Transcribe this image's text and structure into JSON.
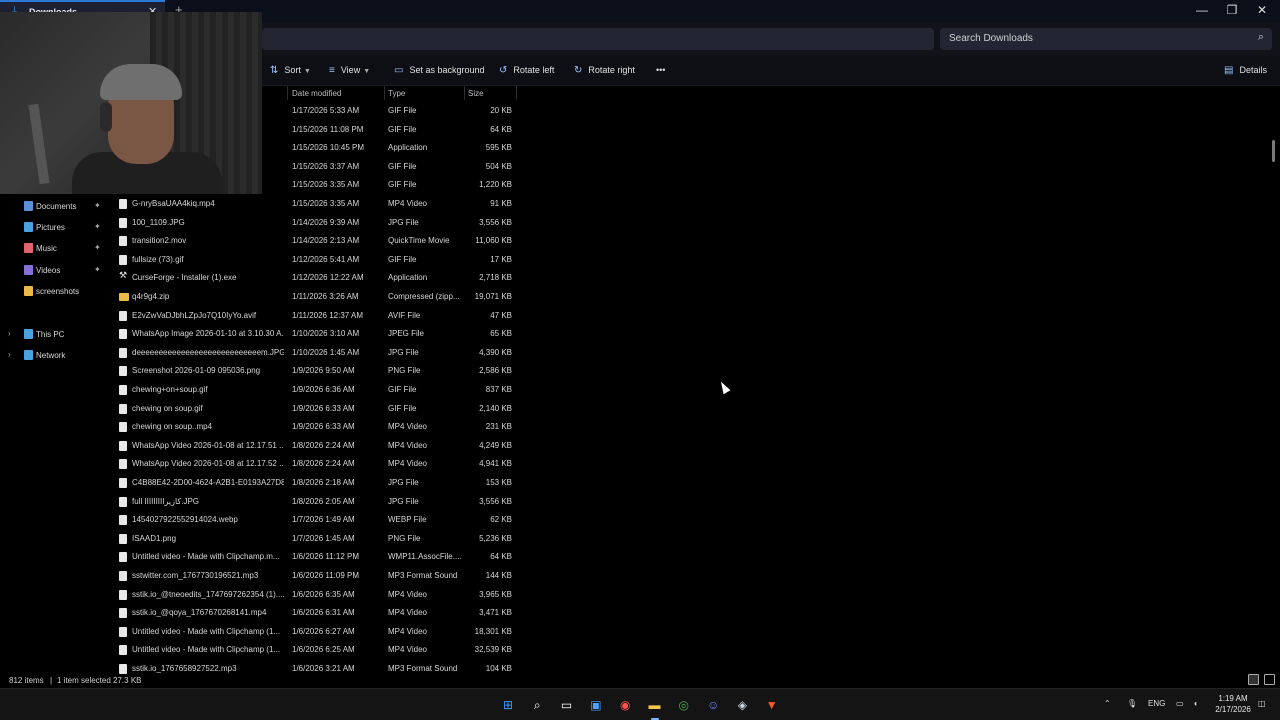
{
  "window": {
    "tab_title": "Downloads",
    "new_tab": "+",
    "close_tab": "✕",
    "minimize": "—",
    "restore": "❐",
    "close": "✕"
  },
  "search": {
    "placeholder": "Search Downloads"
  },
  "toolbar": {
    "sort": "Sort",
    "view": "View",
    "set_background": "Set as background",
    "rotate_left": "Rotate left",
    "rotate_right": "Rotate right",
    "more": "•••",
    "details": "Details"
  },
  "columns": {
    "date": "Date modified",
    "type": "Type",
    "size": "Size"
  },
  "sidebar": {
    "pinned": [
      {
        "label": "Documents",
        "icon": "documents-icon",
        "color": "#5b8fd6"
      },
      {
        "label": "Pictures",
        "icon": "pictures-icon",
        "color": "#4aa3df"
      },
      {
        "label": "Music",
        "icon": "music-icon",
        "color": "#e0646e"
      },
      {
        "label": "Videos",
        "icon": "videos-icon",
        "color": "#8a6fd6"
      },
      {
        "label": "screenshots",
        "icon": "folder-icon",
        "color": "#e9b949"
      }
    ],
    "this_pc": "This PC",
    "network": "Network"
  },
  "files": [
    {
      "name": "",
      "date": "1/17/2026 5:33 AM",
      "type": "GIF File",
      "size": "20 KB"
    },
    {
      "name": "",
      "date": "1/15/2026 11:08 PM",
      "type": "GIF File",
      "size": "64 KB"
    },
    {
      "name": "",
      "date": "1/15/2026 10:45 PM",
      "type": "Application",
      "size": "595 KB"
    },
    {
      "name": "",
      "date": "1/15/2026 3:37 AM",
      "type": "GIF File",
      "size": "504 KB"
    },
    {
      "name": "",
      "date": "1/15/2026 3:35 AM",
      "type": "GIF File",
      "size": "1,220 KB"
    },
    {
      "name": "G-nryBsaUAA4kiq.mp4",
      "date": "1/15/2026 3:35 AM",
      "type": "MP4 Video",
      "size": "91 KB"
    },
    {
      "name": "100_1109.JPG",
      "date": "1/14/2026 9:39 AM",
      "type": "JPG File",
      "size": "3,556 KB"
    },
    {
      "name": "transition2.mov",
      "date": "1/14/2026 2:13 AM",
      "type": "QuickTime Movie",
      "size": "11,060 KB"
    },
    {
      "name": "fullsize (73).gif",
      "date": "1/12/2026 5:41 AM",
      "type": "GIF File",
      "size": "17 KB"
    },
    {
      "name": "CurseForge - Installer (1).exe",
      "date": "1/12/2026 12:22 AM",
      "type": "Application",
      "size": "2,718 KB",
      "kind": "exe"
    },
    {
      "name": "q4r9g4.zip",
      "date": "1/11/2026 3:26 AM",
      "type": "Compressed (zipp...",
      "size": "19,071 KB",
      "kind": "folder"
    },
    {
      "name": "E2vZwVaDJbhLZpJo7Q10IyYo.avif",
      "date": "1/11/2026 12:37 AM",
      "type": "AVIF File",
      "size": "47 KB"
    },
    {
      "name": "WhatsApp Image 2026-01-10 at 3.10.30 A...",
      "date": "1/10/2026 3:10 AM",
      "type": "JPEG File",
      "size": "65 KB"
    },
    {
      "name": "deeeeeeeeeeeeeeeeeeeeeeeeeeeem.JPG",
      "date": "1/10/2026 1:45 AM",
      "type": "JPG File",
      "size": "4,390 KB"
    },
    {
      "name": "Screenshot 2026-01-09 095036.png",
      "date": "1/9/2026 9:50 AM",
      "type": "PNG File",
      "size": "2,586 KB"
    },
    {
      "name": "chewing+on+soup.gif",
      "date": "1/9/2026 6:36 AM",
      "type": "GIF File",
      "size": "837 KB"
    },
    {
      "name": "chewing on soup.gif",
      "date": "1/9/2026 6:33 AM",
      "type": "GIF File",
      "size": "2,140 KB"
    },
    {
      "name": "chewing on soup..mp4",
      "date": "1/9/2026 6:33 AM",
      "type": "MP4 Video",
      "size": "231 KB"
    },
    {
      "name": "WhatsApp Video 2026-01-08 at 12.17.51 ...",
      "date": "1/8/2026 2:24 AM",
      "type": "MP4 Video",
      "size": "4,249 KB"
    },
    {
      "name": "WhatsApp Video 2026-01-08 at 12.17.52 ...",
      "date": "1/8/2026 2:24 AM",
      "type": "MP4 Video",
      "size": "4,941 KB"
    },
    {
      "name": "C4B88E42-2D00-4624-A2B1-E0193A27D8...",
      "date": "1/8/2026 2:18 AM",
      "type": "JPG File",
      "size": "153 KB"
    },
    {
      "name": "full IIIIIIIIكازيرا.JPG",
      "date": "1/8/2026 2:05 AM",
      "type": "JPG File",
      "size": "3,556 KB"
    },
    {
      "name": "1454027922552914024.webp",
      "date": "1/7/2026 1:49 AM",
      "type": "WEBP File",
      "size": "62 KB"
    },
    {
      "name": "ISAAD1.png",
      "date": "1/7/2026 1:45 AM",
      "type": "PNG File",
      "size": "5,236 KB"
    },
    {
      "name": "Untitled video - Made with Clipchamp.m...",
      "date": "1/6/2026 11:12 PM",
      "type": "WMP11.AssocFile....",
      "size": "64 KB"
    },
    {
      "name": "sstwitter.com_1767730196521.mp3",
      "date": "1/6/2026 11:09 PM",
      "type": "MP3 Format Sound",
      "size": "144 KB"
    },
    {
      "name": "sstik.io_@tneoedits_1747697262354 (1)....",
      "date": "1/6/2026 6:35 AM",
      "type": "MP4 Video",
      "size": "3,965 KB"
    },
    {
      "name": "sstik.io_@qoya_1767670268141.mp4",
      "date": "1/6/2026 6:31 AM",
      "type": "MP4 Video",
      "size": "3,471 KB"
    },
    {
      "name": "Untitled video - Made with Clipchamp (1...",
      "date": "1/6/2026 6:27 AM",
      "type": "MP4 Video",
      "size": "18,301 KB"
    },
    {
      "name": "Untitled video - Made with Clipchamp (1...",
      "date": "1/6/2026 6:25 AM",
      "type": "MP4 Video",
      "size": "32,539 KB"
    },
    {
      "name": "sstik.io_1767658927522.mp3",
      "date": "1/6/2026 3:21 AM",
      "type": "MP3 Format Sound",
      "size": "104 KB"
    }
  ],
  "status": {
    "count": "812 items",
    "selected": "1 item selected  27.3 KB"
  },
  "taskbar": {
    "icons": [
      {
        "name": "start-icon",
        "glyph": "⊞",
        "color": "#3a9bff"
      },
      {
        "name": "search-icon",
        "glyph": "⌕",
        "color": "#ffffff"
      },
      {
        "name": "task-view-icon",
        "glyph": "▭",
        "color": "#ffffff"
      },
      {
        "name": "store-icon",
        "glyph": "▣",
        "color": "#4ea0ff"
      },
      {
        "name": "app-icon",
        "glyph": "◉",
        "color": "#ff5050"
      },
      {
        "name": "file-explorer-icon",
        "glyph": "▬",
        "color": "#f3c44c"
      },
      {
        "name": "chrome-icon",
        "glyph": "◎",
        "color": "#4caf50"
      },
      {
        "name": "discord-icon",
        "glyph": "☺",
        "color": "#7a86ff"
      },
      {
        "name": "steam-icon",
        "glyph": "◈",
        "color": "#c7d5e0"
      },
      {
        "name": "brave-icon",
        "glyph": "▼",
        "color": "#ff5a2c"
      }
    ],
    "language": "ENG",
    "time": "1:19 AM",
    "date": "2/17/2026"
  }
}
